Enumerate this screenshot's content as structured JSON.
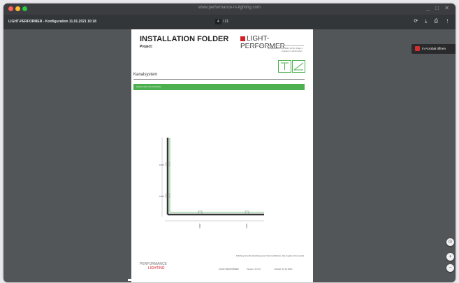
{
  "browser": {
    "url": "www.performance-in-lighting.com",
    "window_controls": "_ □ ✕"
  },
  "toolbar": {
    "doc_title": "LIGHT-PERFORMER - Konfiguration 11.01.2021 10:18",
    "page_current": "4",
    "page_total": "/ 21",
    "icons": [
      "rotate-icon",
      "download-icon",
      "print-icon",
      "more-icon"
    ]
  },
  "acrobat": {
    "label": "In Acrobat öffnen"
  },
  "page": {
    "title": "INSTALLATION FOLDER",
    "project_label": "Project:",
    "brand": "LIGHT-PERFORMER",
    "meta_line1": "Konfiguration 11.01.2021 10:18  •  Page 4",
    "meta_line2": "Angaben in Zentimetern",
    "section_title": "Kanalsystem",
    "green_bar_text": "Light-Leiste und Anschluss",
    "note": "Abbildung ohne Berücksichtigung der Seitenverhältnisse. Alle Angaben ohne Gewähr.",
    "footer_logo_line1": "PERFORMANCE",
    "footer_logo_line2": "LIGHTING",
    "footer_company": "LIGHT-PERFORMER",
    "footer_version": "Version: 2.21.0",
    "footer_date": "Erstellt: 11.01.2021"
  },
  "diagram": {
    "labels": [
      "1000",
      "1000",
      "2000",
      "2000"
    ]
  },
  "fabs": [
    "fit-to-page-icon",
    "zoom-in-icon",
    "zoom-out-icon"
  ],
  "fab_glyphs": [
    "⊙",
    "+",
    "−"
  ]
}
